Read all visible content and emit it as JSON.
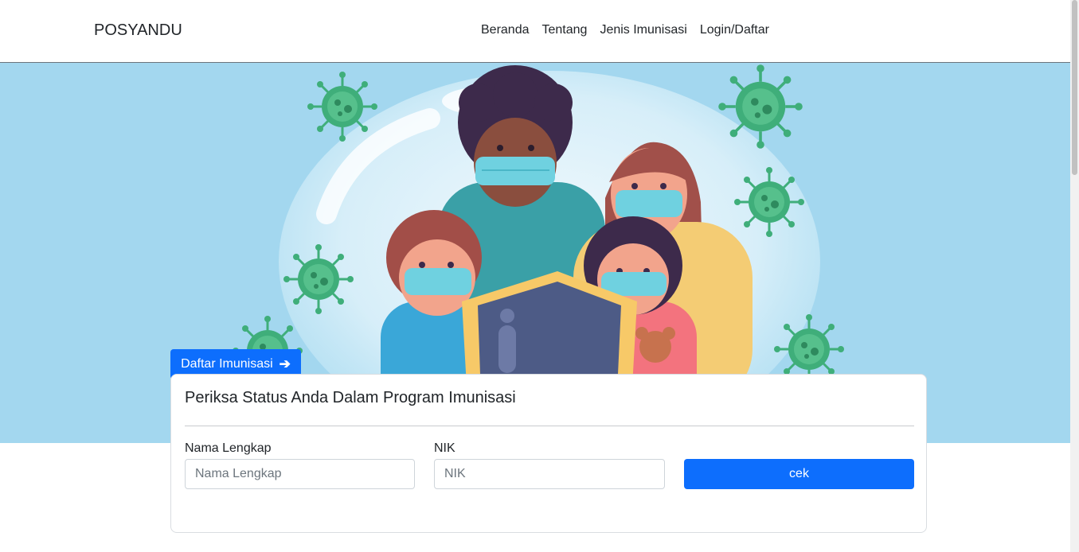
{
  "navbar": {
    "brand": "POSYANDU",
    "links": [
      "Beranda",
      "Tentang",
      "Jenis Imunisasi",
      "Login/Daftar"
    ]
  },
  "hero": {
    "button_label": "Daftar Imunisasi",
    "button_icon": "arrow-right-icon",
    "background_color": "#a3d7ef"
  },
  "check_card": {
    "title": "Periksa Status Anda Dalam Program Imunisasi",
    "name_label": "Nama Lengkap",
    "name_placeholder": "Nama Lengkap",
    "name_value": "",
    "nik_label": "NIK",
    "nik_placeholder": "NIK",
    "nik_value": "",
    "submit_label": "cek"
  },
  "colors": {
    "primary": "#0d6efd",
    "virus": "#3fae7a",
    "mask": "#6fd1e0"
  }
}
